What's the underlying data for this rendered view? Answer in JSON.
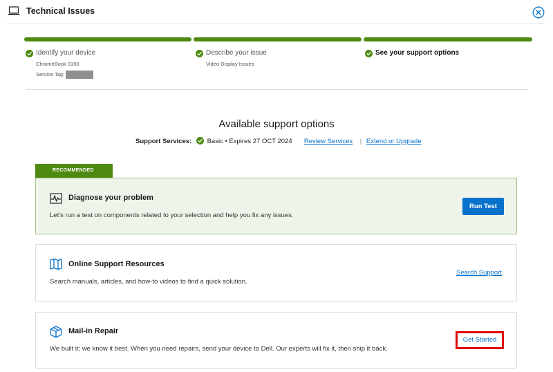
{
  "header": {
    "title": "Technical Issues"
  },
  "steps": [
    {
      "label": "Identify your device",
      "sub1": "ChromeBook 3100",
      "sub2": "Service Tag:"
    },
    {
      "label": "Describe your issue",
      "sub1": "Video Display Issues"
    },
    {
      "label": "See your support options"
    }
  ],
  "main": {
    "title": "Available support options",
    "services_label": "Support Services:",
    "services_value": "Basic • Expires 27 OCT 2024",
    "review_link": "Review Services",
    "separator": "|",
    "extend_link": "Extend or Upgrade"
  },
  "recommended": {
    "badge": "RECOMMENDED",
    "title": "Diagnose your problem",
    "desc": "Let's run a test on components related to your selection and help you fix any issues.",
    "button": "Run Test"
  },
  "online": {
    "title": "Online Support Resources",
    "desc": "Search manuals, articles, and how-to videos to find a quick solution.",
    "link": "Search Support"
  },
  "mail": {
    "title": "Mail-in Repair",
    "desc": "We built it; we know it best. When you need repairs, send your device to Dell. Our experts will fix it, then ship it back.",
    "button": "Get Started"
  },
  "icons": {
    "header": "laptop-icon",
    "close": "close-icon",
    "step": "check-circle-icon",
    "diagnose": "pulse-monitor-icon",
    "online": "open-book-icon",
    "mail": "package-box-icon"
  },
  "colors": {
    "accent_green": "#4e8a12",
    "link_blue": "#0672cb",
    "highlight_red": "#e00000"
  }
}
